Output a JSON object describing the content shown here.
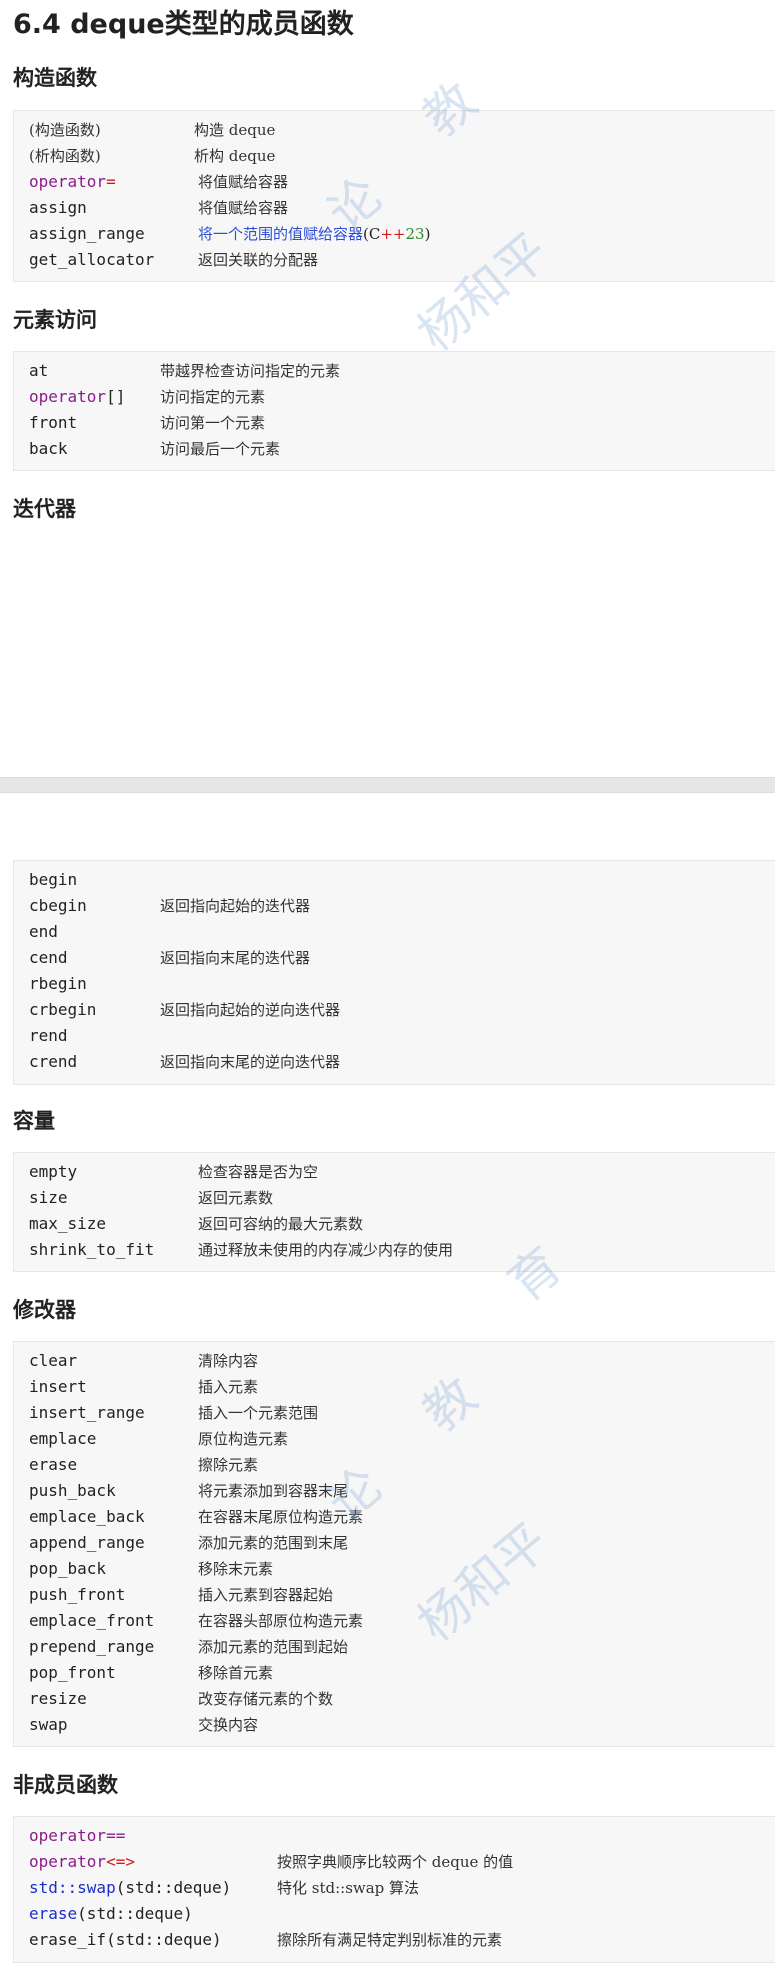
{
  "title": "6.4 deque类型的成员函数",
  "sections": {
    "constructors": {
      "heading": "构造函数",
      "rows": [
        {
          "code": "(构造函数)",
          "desc": "构造 deque"
        },
        {
          "code": "(析构函数)",
          "desc": "析构 deque"
        },
        {
          "code_kw": "operator",
          "code_sym": "=",
          "desc": "将值赋给容器"
        },
        {
          "code": "assign",
          "desc": "将值赋给容器"
        },
        {
          "code": "assign_range",
          "desc_link": "将一个范围的值赋给容器",
          "ver_c": "(C",
          "ver_pp": "++",
          "ver_num": "23",
          "ver_end": ")"
        },
        {
          "code": "get_allocator",
          "desc": "返回关联的分配器"
        }
      ]
    },
    "access": {
      "heading": "元素访问",
      "rows": [
        {
          "code": "at",
          "desc": "带越界检查访问指定的元素"
        },
        {
          "code_kw": "operator",
          "code_sym": "[]",
          "desc": "访问指定的元素"
        },
        {
          "code": "front",
          "desc": "访问第一个元素"
        },
        {
          "code": "back",
          "desc": "访问最后一个元素"
        }
      ]
    },
    "iterators": {
      "heading": "迭代器",
      "rows": [
        {
          "code": "begin",
          "desc": ""
        },
        {
          "code": "cbegin",
          "desc": "返回指向起始的迭代器"
        },
        {
          "code": "end",
          "desc": ""
        },
        {
          "code": "cend",
          "desc": "返回指向末尾的迭代器"
        },
        {
          "code": "rbegin",
          "desc": ""
        },
        {
          "code": "crbegin",
          "desc": "返回指向起始的逆向迭代器"
        },
        {
          "code": "rend",
          "desc": ""
        },
        {
          "code": "crend",
          "desc": "返回指向末尾的逆向迭代器"
        }
      ]
    },
    "capacity": {
      "heading": "容量",
      "rows": [
        {
          "code": "empty",
          "desc": "检查容器是否为空"
        },
        {
          "code": "size",
          "desc": "返回元素数"
        },
        {
          "code": "max_size",
          "desc": "返回可容纳的最大元素数"
        },
        {
          "code": "shrink_to_fit",
          "desc": "通过释放未使用的内存减少内存的使用"
        }
      ]
    },
    "modifiers": {
      "heading": "修改器",
      "rows": [
        {
          "code": "clear",
          "desc": "清除内容"
        },
        {
          "code": "insert",
          "desc": "插入元素"
        },
        {
          "code": "insert_range",
          "desc": "插入一个元素范围"
        },
        {
          "code": "emplace",
          "desc": "原位构造元素"
        },
        {
          "code": "erase",
          "desc": "擦除元素"
        },
        {
          "code": "push_back",
          "desc": "将元素添加到容器末尾"
        },
        {
          "code": "emplace_back",
          "desc": "在容器末尾原位构造元素"
        },
        {
          "code": "append_range",
          "desc": "添加元素的范围到末尾"
        },
        {
          "code": "pop_back",
          "desc": "移除末元素"
        },
        {
          "code": "push_front",
          "desc": "插入元素到容器起始"
        },
        {
          "code": "emplace_front",
          "desc": "在容器头部原位构造元素"
        },
        {
          "code": "prepend_range",
          "desc": "添加元素的范围到起始"
        },
        {
          "code": "pop_front",
          "desc": "移除首元素"
        },
        {
          "code": "resize",
          "desc": "改变存储元素的个数"
        },
        {
          "code": "swap",
          "desc": "交换内容"
        }
      ]
    },
    "nonmember": {
      "heading": "非成员函数",
      "rows": [
        {
          "code_kw": "operator",
          "code_sym": "==",
          "desc": ""
        },
        {
          "code_kw": "operator",
          "code_sym": "<=>",
          "desc": "按照字典顺序比较两个 deque 的值"
        },
        {
          "code_ns": "std::swap",
          "code_rest": "(std::deque)",
          "desc": "特化 std::swap 算法"
        },
        {
          "code_ns": "erase",
          "code_rest": "(std::deque)",
          "desc": ""
        },
        {
          "code": "erase_if(std::deque)",
          "desc": "擦除所有满足特定判别标准的元素"
        }
      ]
    }
  },
  "watermark": {
    "text_a": "教",
    "text_b": "论",
    "text_c": "杨和平",
    "text_d": "育"
  }
}
